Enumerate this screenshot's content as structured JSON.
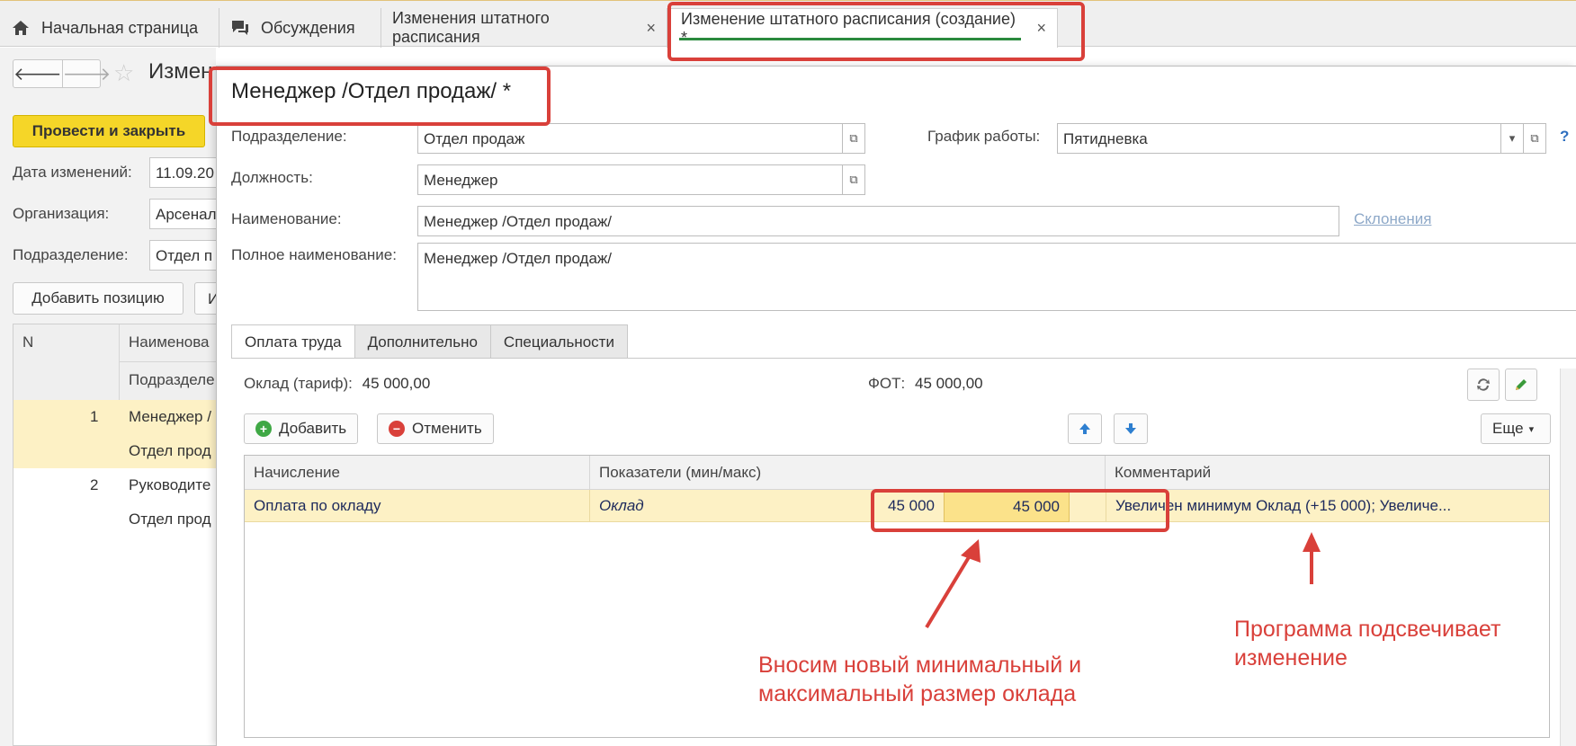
{
  "tabs": [
    {
      "label": "Начальная страница",
      "icon": "home-icon"
    },
    {
      "label": "Обсуждения",
      "icon": "chat-icon"
    },
    {
      "label": "Изменения штатного расписания",
      "close": "×"
    },
    {
      "label": "Изменение штатного расписания (создание) *",
      "close": "×"
    }
  ],
  "background_form": {
    "title": "Измен",
    "post_button": "Провести и закрыть",
    "fields": [
      {
        "label": "Дата изменений:",
        "value": "11.09.20"
      },
      {
        "label": "Организация:",
        "value": "Арсенал"
      },
      {
        "label": "Подразделение:",
        "value": "Отдел п"
      }
    ],
    "add_position_button": "Добавить позицию",
    "second_button": "И",
    "table": {
      "headers": [
        "N",
        "Наименова",
        "Подразделе"
      ],
      "rows": [
        {
          "n": "1",
          "name": "Менеджер /",
          "dept": "Отдел прод"
        },
        {
          "n": "2",
          "name": "Руководите",
          "dept": "Отдел прод"
        }
      ]
    }
  },
  "modal": {
    "title": "Менеджер /Отдел продаж/ *",
    "subdivision_label": "Подразделение:",
    "subdivision_value": "Отдел продаж",
    "schedule_label": "График работы:",
    "schedule_value": "Пятидневка",
    "position_label": "Должность:",
    "position_value": "Менеджер",
    "name_label": "Наименование:",
    "name_value": "Менеджер /Отдел продаж/",
    "declension_link": "Склонения",
    "full_name_label": "Полное наименование:",
    "full_name_value": "Менеджер /Отдел продаж/",
    "help": "?",
    "tabs": [
      "Оплата труда",
      "Дополнительно",
      "Специальности"
    ],
    "salary_label": "Оклад (тариф):",
    "salary_value": "45 000,00",
    "fot_label": "ФОТ:",
    "fot_value": "45 000,00",
    "add_button": "Добавить",
    "cancel_button": "Отменить",
    "more_button": "Еще",
    "grid": {
      "headers": [
        "Начисление",
        "Показатели (мин/макс)",
        "Комментарий"
      ],
      "row": {
        "accrual": "Оплата по окладу",
        "indicator": "Оклад",
        "min": "45 000",
        "max": "45 000",
        "comment": "Увеличен минимум Оклад (+15 000); Увеличе..."
      }
    }
  },
  "annotations": {
    "left": "Вносим новый минимальный и максимальный размер оклада",
    "right": "Программа подсвечивает изменение"
  },
  "colors": {
    "accent_red": "#d9403a",
    "row_highlight": "#fdf1c5",
    "cell_highlight": "#fbe28a",
    "post_button": "#f5d628",
    "active_tab_underline": "#2a8a3e"
  }
}
